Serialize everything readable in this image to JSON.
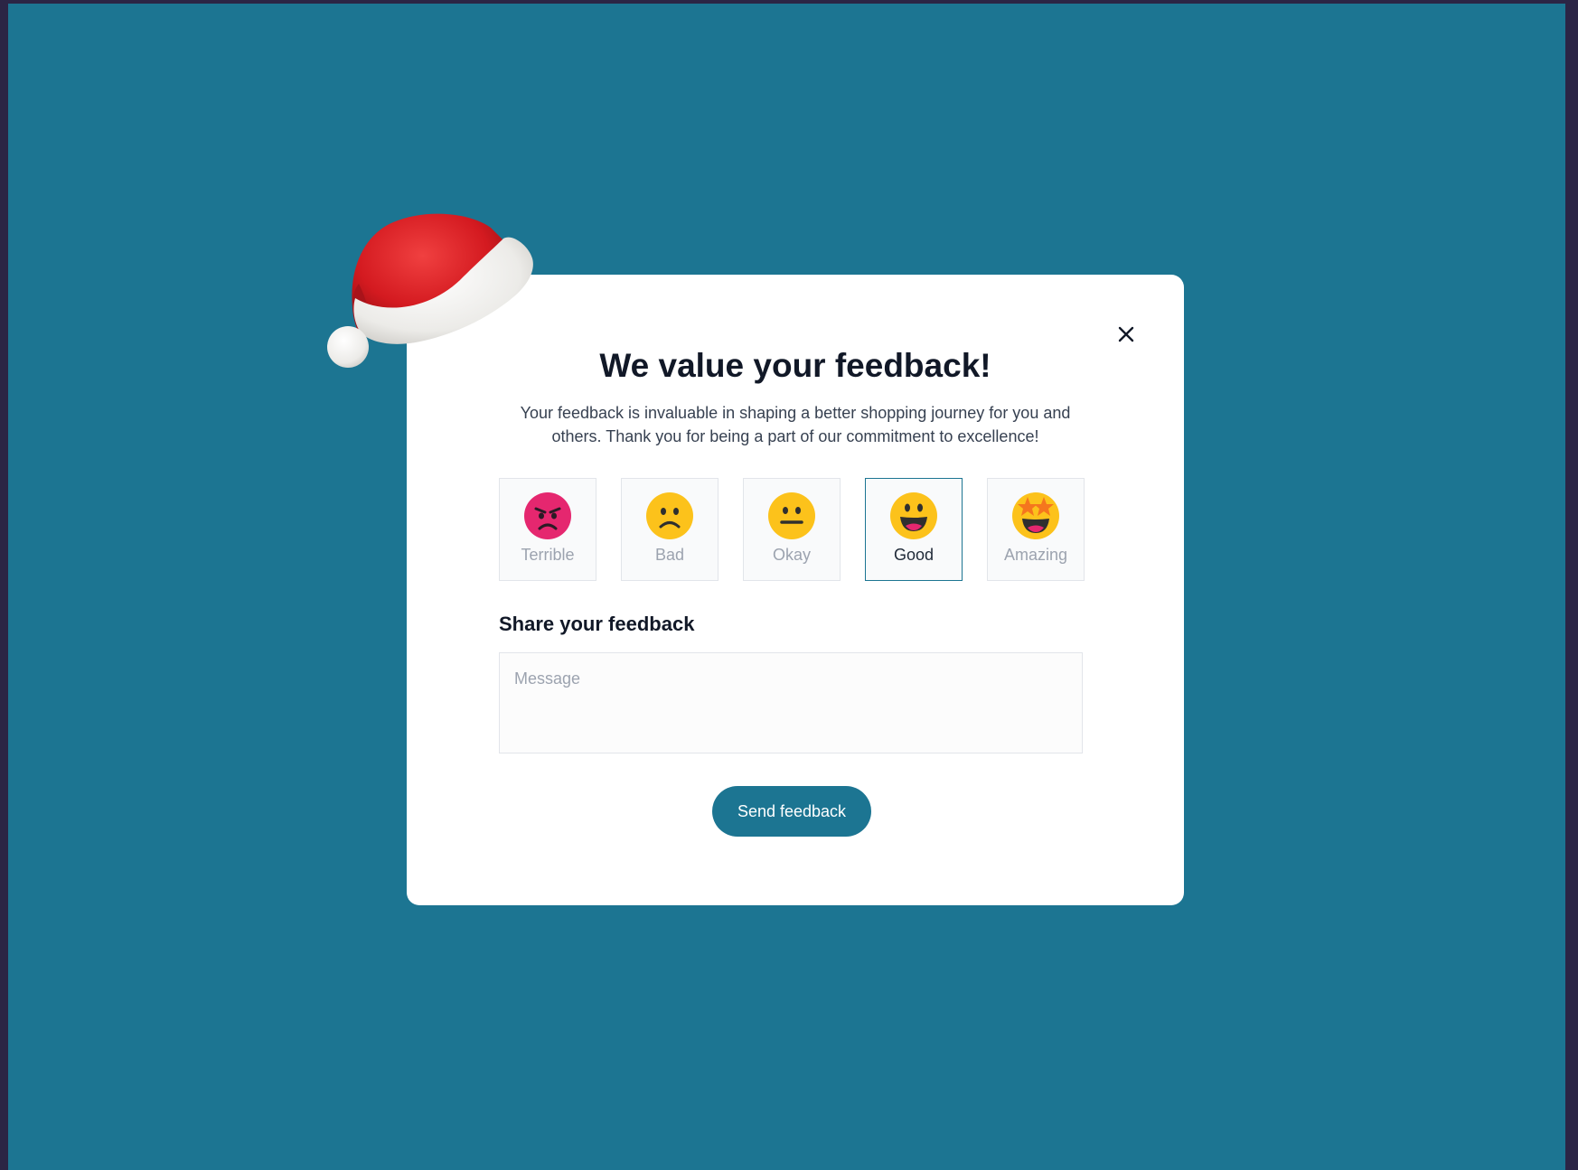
{
  "modal": {
    "title": "We value your feedback!",
    "subtitle": "Your feedback is invaluable in shaping a better shopping journey for you and others. Thank you for being a part of our commitment to excellence!",
    "close_icon": "close-icon",
    "decoration_icon": "santa-hat-icon"
  },
  "ratings": [
    {
      "label": "Terrible",
      "icon": "angry-face-icon",
      "selected": false
    },
    {
      "label": "Bad",
      "icon": "frowning-face-icon",
      "selected": false
    },
    {
      "label": "Okay",
      "icon": "neutral-face-icon",
      "selected": false
    },
    {
      "label": "Good",
      "icon": "grinning-face-icon",
      "selected": true
    },
    {
      "label": "Amazing",
      "icon": "star-struck-face-icon",
      "selected": false
    }
  ],
  "feedback": {
    "label": "Share your feedback",
    "placeholder": "Message",
    "value": ""
  },
  "send_button": {
    "label": "Send feedback"
  },
  "colors": {
    "background": "#1c7592",
    "frame": "#2b2545",
    "accent": "#1c7592",
    "card": "#ffffff"
  }
}
